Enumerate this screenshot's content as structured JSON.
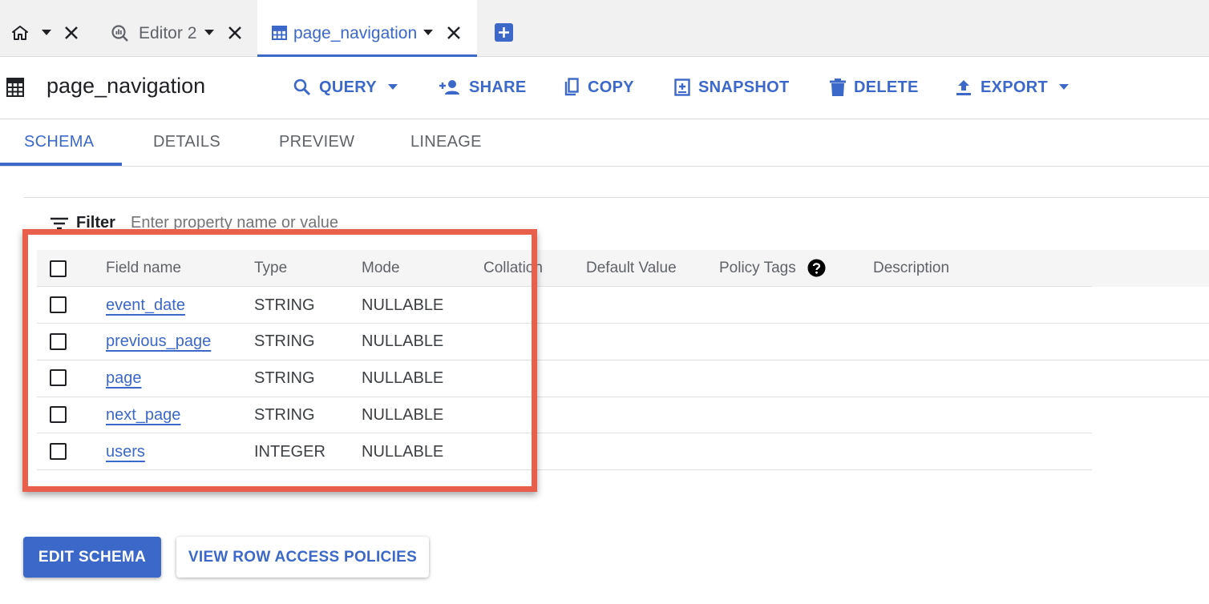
{
  "tabs": [
    {
      "label": "",
      "icon": "home-icon"
    },
    {
      "label": "Editor 2",
      "icon": "query-icon"
    },
    {
      "label": "page_navigation",
      "icon": "table-icon",
      "active": true
    }
  ],
  "table_title": "page_navigation",
  "toolbar": {
    "query": "QUERY",
    "share": "SHARE",
    "copy": "COPY",
    "snapshot": "SNAPSHOT",
    "delete": "DELETE",
    "export": "EXPORT"
  },
  "subtabs": [
    "SCHEMA",
    "DETAILS",
    "PREVIEW",
    "LINEAGE"
  ],
  "filter": {
    "label": "Filter",
    "placeholder": "Enter property name or value"
  },
  "columns": [
    "Field name",
    "Type",
    "Mode",
    "Collation",
    "Default Value",
    "Policy Tags",
    "Description"
  ],
  "rows": [
    {
      "name": "event_date",
      "type": "STRING",
      "mode": "NULLABLE"
    },
    {
      "name": "previous_page",
      "type": "STRING",
      "mode": "NULLABLE"
    },
    {
      "name": "page",
      "type": "STRING",
      "mode": "NULLABLE"
    },
    {
      "name": "next_page",
      "type": "STRING",
      "mode": "NULLABLE"
    },
    {
      "name": "users",
      "type": "INTEGER",
      "mode": "NULLABLE"
    }
  ],
  "buttons": {
    "edit_schema": "EDIT SCHEMA",
    "view_row_access": "VIEW ROW ACCESS POLICIES"
  },
  "colors": {
    "accent": "#3b68c9",
    "highlight": "#e8604c"
  }
}
